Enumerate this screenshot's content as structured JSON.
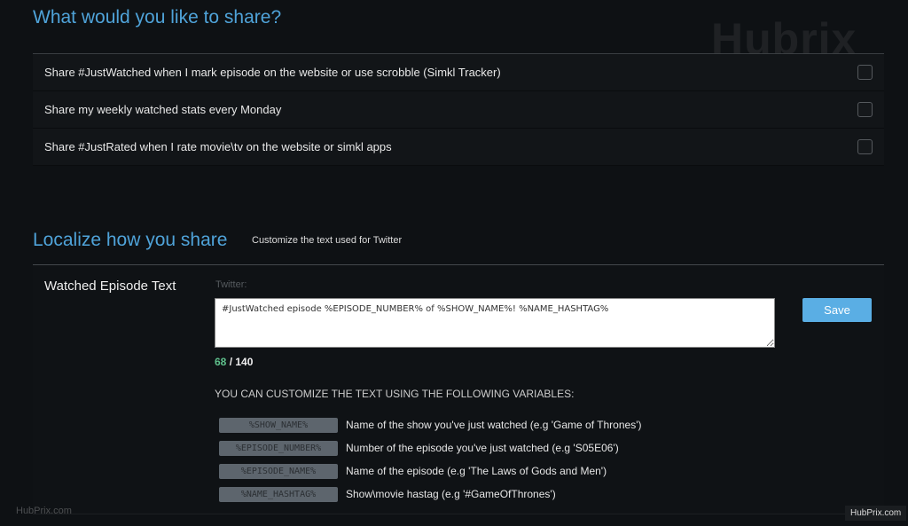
{
  "share": {
    "title": "What would you like to share?",
    "options": [
      {
        "label": "Share #JustWatched when I mark episode on the website or use scrobble (Simkl Tracker)",
        "checked": false
      },
      {
        "label": "Share my weekly watched stats every Monday",
        "checked": false
      },
      {
        "label": "Share #JustRated when I rate movie\\tv on the website or simkl apps",
        "checked": false
      }
    ]
  },
  "localize": {
    "title": "Localize how you share",
    "subtitle": "Customize the text used for Twitter",
    "section_label": "Watched Episode Text",
    "field_label": "Twitter:",
    "text_value": "#JustWatched episode %EPISODE_NUMBER% of %SHOW_NAME%! %NAME_HASHTAG%",
    "save_label": "Save",
    "count_used": "68",
    "count_max": " / 140",
    "variables_heading": "YOU CAN CUSTOMIZE THE TEXT USING THE FOLLOWING VARIABLES:",
    "variables": [
      {
        "tag": "%SHOW_NAME%",
        "desc": "Name of the show you've just watched (e.g 'Game of Thrones')"
      },
      {
        "tag": "%EPISODE_NUMBER%",
        "desc": "Number of the episode you've just watched (e.g 'S05E06')"
      },
      {
        "tag": "%EPISODE_NAME%",
        "desc": "Name of the episode (e.g 'The Laws of Gods and Men')"
      },
      {
        "tag": "%NAME_HASHTAG%",
        "desc": "Show\\movie hastag (e.g '#GameOfThrones')"
      }
    ]
  },
  "watermarks": {
    "logo": "Hubrix",
    "bottom_left": "HubPrix.com",
    "bottom_right": "HubPrix.com"
  },
  "colors": {
    "accent": "#4fa3d9",
    "save": "#5aaee4",
    "count_used": "#5fc08c",
    "background": "#0e1114"
  }
}
